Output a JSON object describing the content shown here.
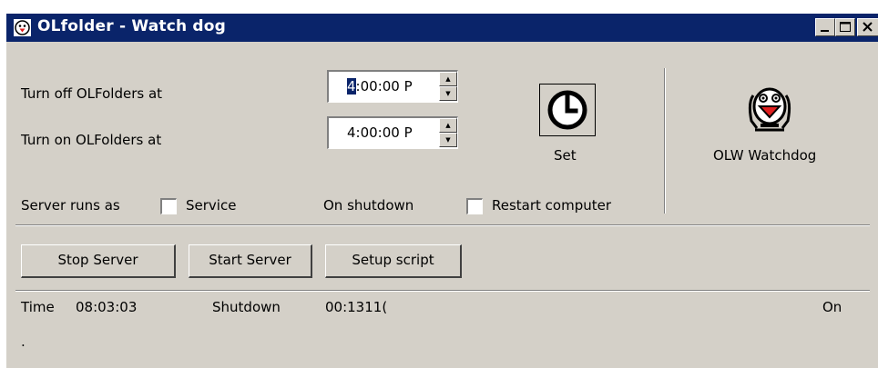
{
  "window": {
    "title": "OLfolder - Watch dog",
    "controls": {
      "minimize": "_",
      "maximize": "□",
      "close": "X"
    }
  },
  "schedule": {
    "turn_off_label": "Turn off OLFolders at",
    "turn_off_caret": "4",
    "turn_off_value": ":00:00 P",
    "turn_on_label": "Turn on OLFolders at",
    "turn_on_value": "4:00:00 P",
    "set_label": "Set",
    "set_icon": "clock-icon"
  },
  "options": {
    "server_runs_as_label": "Server runs as",
    "service_label": "Service",
    "service_checked": false,
    "on_shutdown_label": "On shutdown",
    "restart_label": "Restart computer",
    "restart_checked": false
  },
  "watchdog": {
    "label": "OLW Watchdog",
    "icon": "watchdog-icon"
  },
  "buttons": {
    "stop": "Stop Server",
    "start": "Start Server",
    "setup": "Setup script"
  },
  "status": {
    "time_label": "Time",
    "time_value": "08:03:03",
    "shutdown_label": "Shutdown",
    "shutdown_value": "00:1311(",
    "state": "On",
    "extra": "."
  },
  "colors": {
    "titlebar": "#0a246a",
    "face": "#d4d0c8",
    "icon_red": "#e02020"
  }
}
